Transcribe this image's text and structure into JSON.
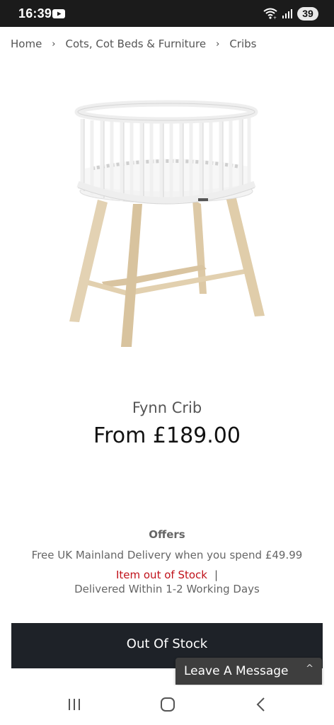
{
  "status_bar": {
    "time": "16:39",
    "battery": "39",
    "icons": [
      "youtube-icon",
      "wifi-icon",
      "signal-icon",
      "battery-icon"
    ]
  },
  "breadcrumb": {
    "items": [
      "Home",
      "Cots, Cot Beds & Furniture",
      "Cribs"
    ],
    "separator": "›"
  },
  "product": {
    "title": "Fynn Crib",
    "price": "From £189.00"
  },
  "offers": {
    "heading": "Offers",
    "text": "Free UK Mainland Delivery when you spend £49.99",
    "stock_status": "Item out of Stock",
    "divider": "|",
    "delivery": "Delivered Within 1-2 Working Days"
  },
  "actions": {
    "out_of_stock_label": "Out Of Stock",
    "leave_message_label": "Leave A Message",
    "leave_message_caret": "^"
  },
  "colors": {
    "status_bar": "#1b1b1b",
    "button": "#1e2228",
    "out_of_stock_red": "#c0111a",
    "chat_widget": "#3e3e3e"
  },
  "nav_bar": {
    "icons": [
      "recent-apps-icon",
      "home-icon",
      "back-icon"
    ]
  }
}
